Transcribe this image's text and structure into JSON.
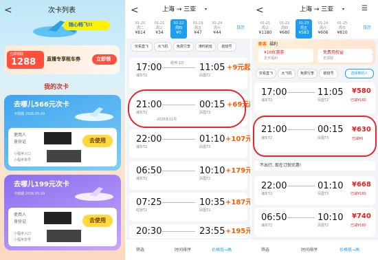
{
  "p1": {
    "back": "<",
    "title": "次卡列表",
    "banner_tag": "随心畅飞!!",
    "promo": {
      "badge_top": "立即领取",
      "amount": "1288",
      "text": "直播专享租车券",
      "button": "立即领"
    },
    "section_title": "我的次卡",
    "cards": [
      {
        "title": "去哪儿566元次卡",
        "sub": "卡效期 2026.05.09",
        "user": "使用人",
        "id": "身份证",
        "entry": "小程序入口",
        "entry2": "小程序单号",
        "button": "去使用"
      },
      {
        "title": "去哪儿199元次卡",
        "sub": "卡效期 2026.05.09",
        "user": "使用人",
        "id": "身份证",
        "entry": "小程序入口",
        "entry2": "小程序单号",
        "button": "去使用"
      }
    ]
  },
  "p2": {
    "back": "<",
    "route": "上海 → 三亚",
    "dates": [
      {
        "d": "01-20",
        "w": "周二",
        "p": "¥814"
      },
      {
        "d": "01-21",
        "w": "周三",
        "p": "¥34"
      },
      {
        "d": "01-22",
        "w": "周四",
        "p": "¥0"
      },
      {
        "d": "01-23",
        "w": "周五",
        "p": "¥47"
      },
      {
        "d": "01-24",
        "w": "周六",
        "p": "¥44"
      }
    ],
    "calendar": "日历",
    "chips": [
      "仅看直飞",
      "大飞机",
      "免费行李",
      "准时航班",
      "航班号"
    ],
    "flights": [
      {
        "dep": "17:00",
        "arr": "11:05",
        "dapt": "浦东T2",
        "aapt": "凤凰T2",
        "stop": "经停 1次",
        "price": "+9元起"
      },
      {
        "dep": "21:00",
        "arr": "00:15",
        "dapt": "浦东T2",
        "aapt": "凤凰T3",
        "stop": "2026年11月",
        "price": "+69元起"
      },
      {
        "dep": "22:00",
        "arr": "01:10",
        "dapt": "浦东T2",
        "aapt": "凤凰T3",
        "stop": "",
        "price": "+107元起"
      },
      {
        "dep": "06:50",
        "arr": "10:10",
        "dapt": "浦东T2",
        "aapt": "凤凰T2",
        "stop": "",
        "price": "+179元起"
      },
      {
        "dep": "07:25",
        "arr": "10:35",
        "dapt": "虹桥T2",
        "aapt": "凤凰T2",
        "stop": "",
        "price": "+187元起"
      },
      {
        "dep": "20:30",
        "arr": "23:55",
        "dapt": "",
        "aapt": "",
        "stop": "",
        "price": "+195元起"
      }
    ],
    "bottom": [
      "筛选",
      "时间排序",
      "价格低→高"
    ]
  },
  "p3": {
    "back": "<",
    "route": "上海 → 三亚",
    "dates": [
      {
        "d": "01-21",
        "w": "周三",
        "p": "¥1180"
      },
      {
        "d": "01-22",
        "w": "周四",
        "p": "¥680"
      },
      {
        "d": "01-23",
        "w": "周五",
        "p": "¥583"
      },
      {
        "d": "01-24",
        "w": "周六",
        "p": "¥606"
      },
      {
        "d": "01-25",
        "w": "周日",
        "p": "¥810"
      }
    ],
    "calendar": "日历",
    "notice": {
      "tag": "新客",
      "title": "福利",
      "left": "¥10优惠券",
      "left_sub": "天天福利",
      "right": "免费用权益",
      "right_sub": "去领取"
    },
    "chips": [
      "仅看直飞",
      "大飞机",
      "免费行李",
      "航班号"
    ],
    "select": "选择乘机人",
    "flights": [
      {
        "dep": "17:00",
        "arr": "11:05",
        "dapt": "浦东T2",
        "aapt": "凤凰T2",
        "price": "¥580",
        "tag": "已减¥160"
      },
      {
        "dep": "21:00",
        "arr": "00:15",
        "dapt": "浦东T2",
        "aapt": "凤凰T3",
        "price": "¥630",
        "tag": "已减¥0"
      },
      {
        "dep": "22:00",
        "arr": "01:10",
        "dapt": "浦东T2",
        "aapt": "凤凰T3",
        "price": "¥668",
        "tag": "已减¥160"
      },
      {
        "dep": "06:50",
        "arr": "10:10",
        "dapt": "浦东T2",
        "aapt": "凤凰T2",
        "price": "¥740",
        "tag": "已减¥160"
      }
    ],
    "fly_notice": "不出行, 现在订就优惠!",
    "bottom": [
      "筛选",
      "时间排序",
      "价格低→高"
    ]
  },
  "colors": {
    "accent": "#1f9cf0",
    "price": "#ff5a00",
    "highlight": "#e8232a"
  }
}
